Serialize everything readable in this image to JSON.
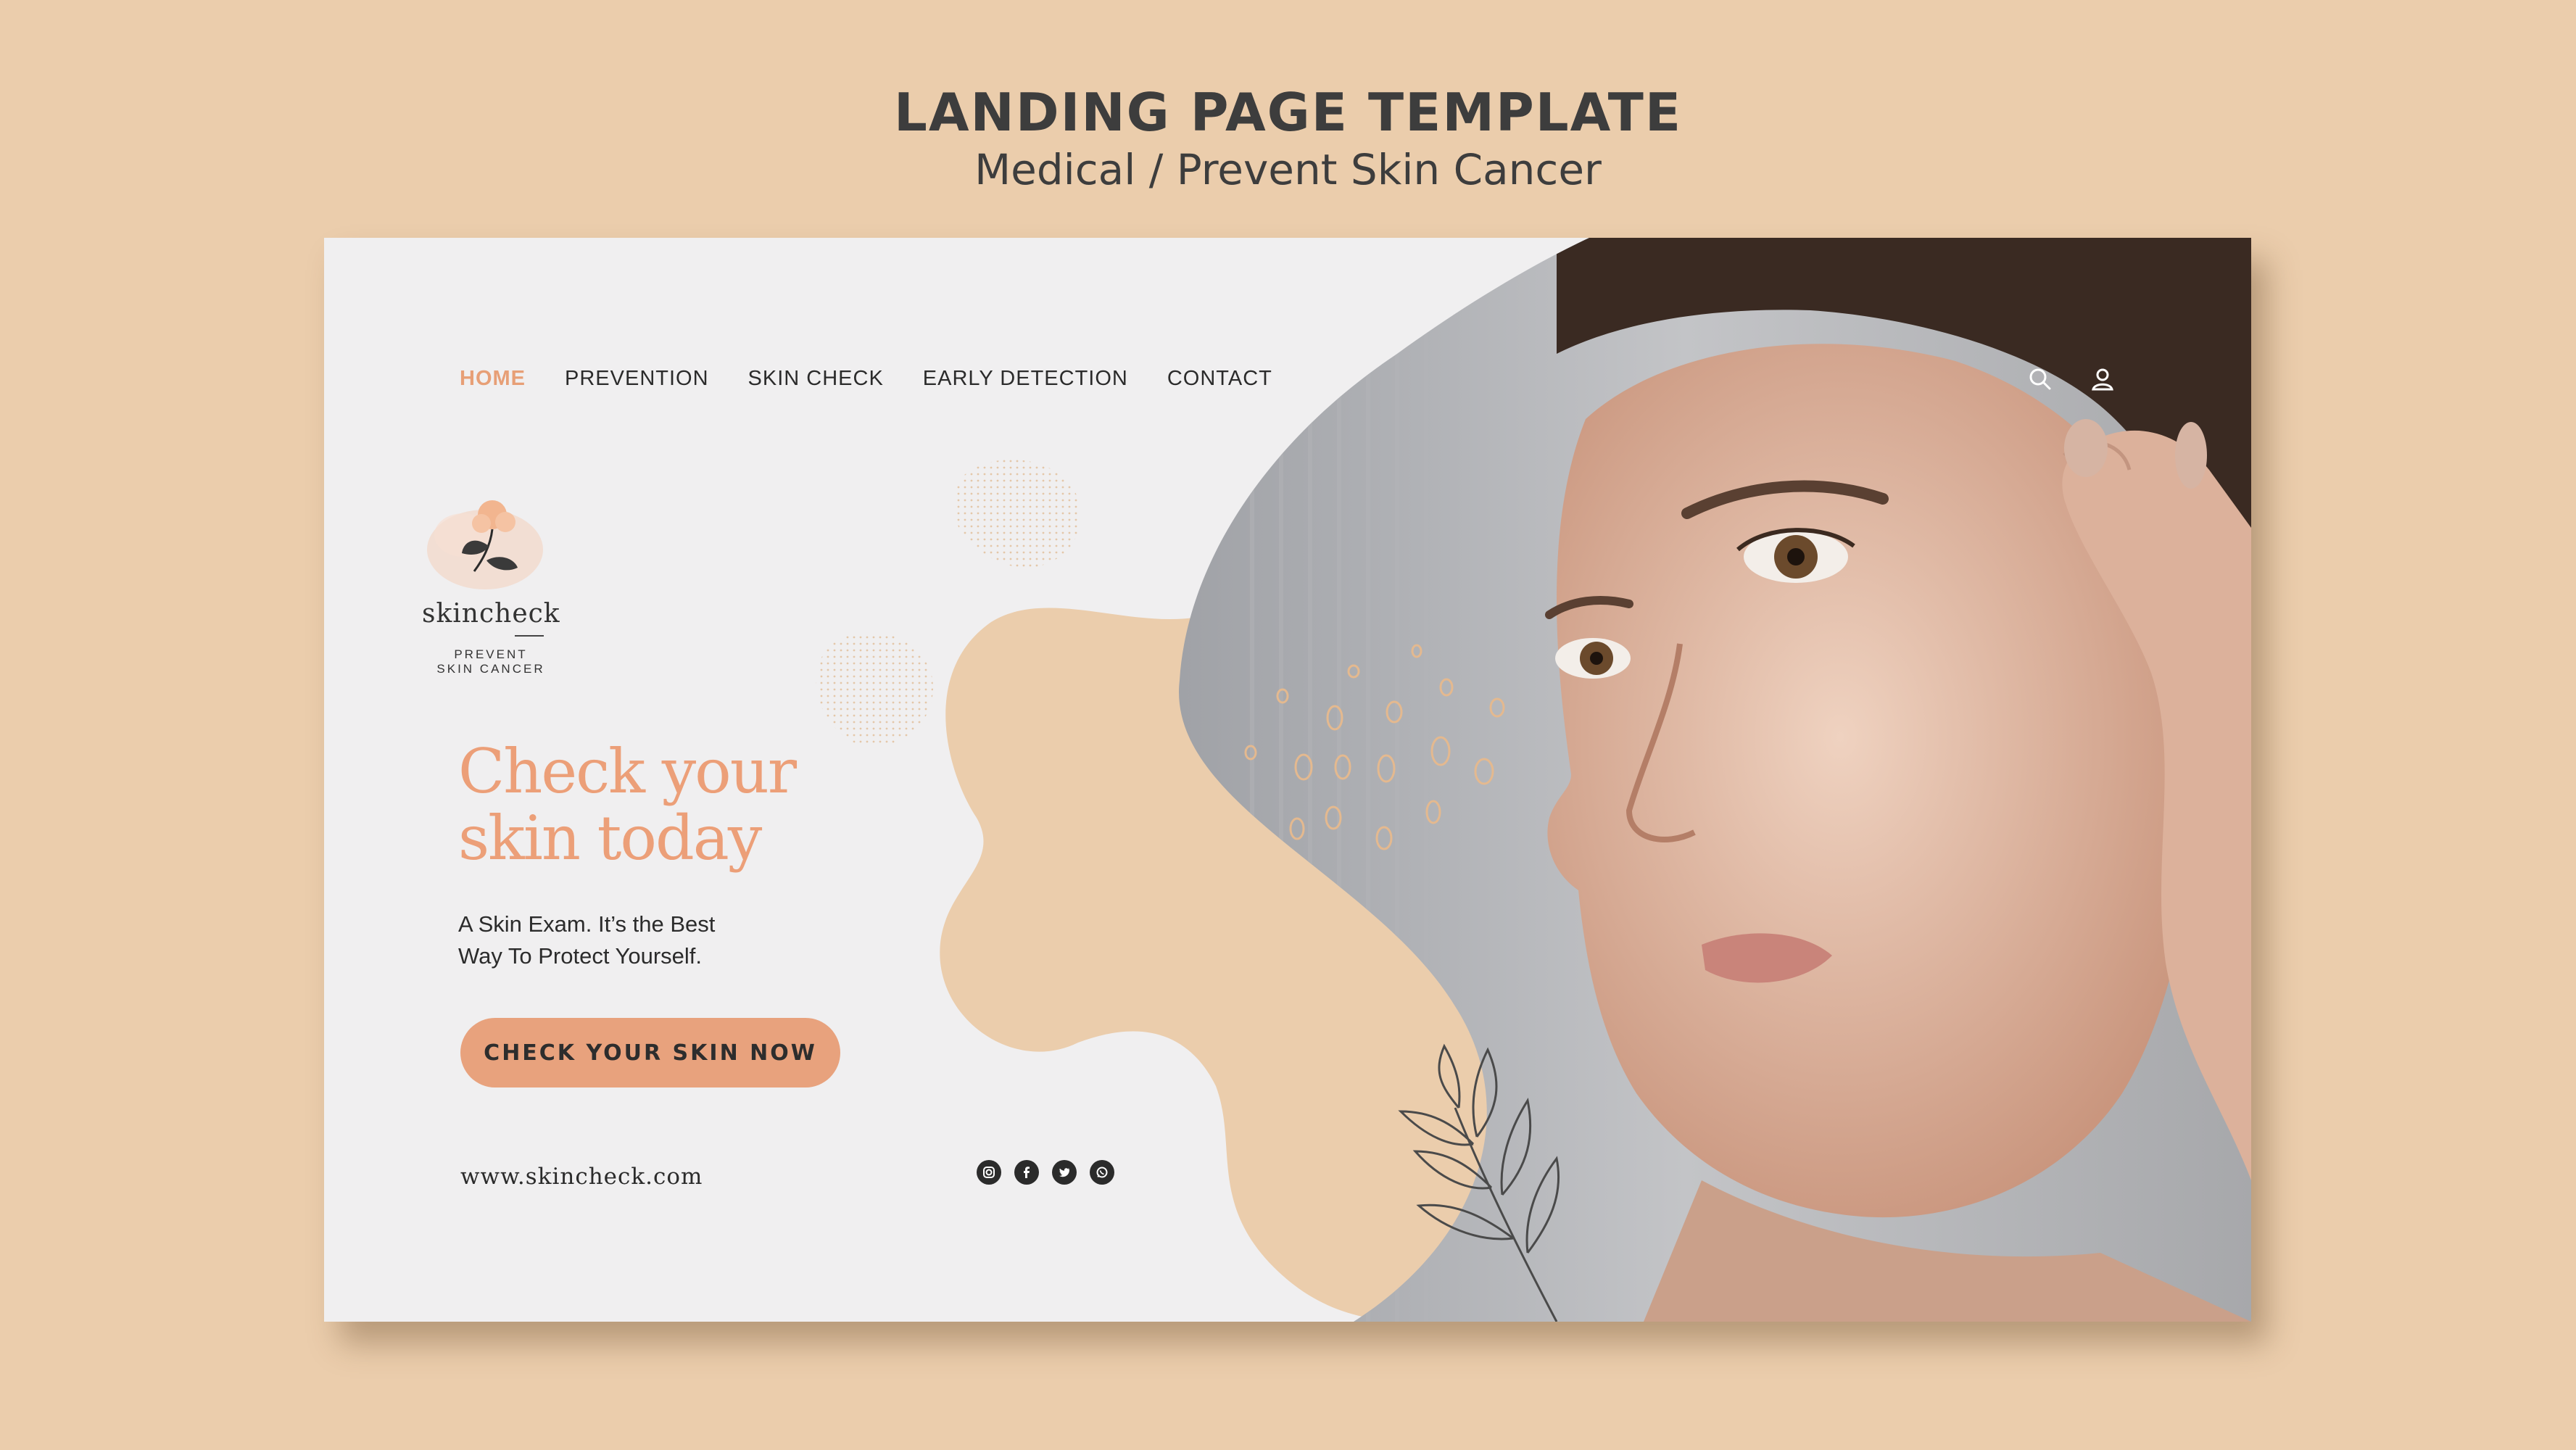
{
  "header": {
    "title": "LANDING PAGE TEMPLATE",
    "subtitle": "Medical / Prevent Skin Cancer"
  },
  "nav": {
    "items": [
      {
        "label": "HOME",
        "active": true
      },
      {
        "label": "PREVENTION"
      },
      {
        "label": "SKIN CHECK"
      },
      {
        "label": "EARLY DETECTION"
      },
      {
        "label": "CONTACT"
      }
    ]
  },
  "icons": [
    "search-icon",
    "user-icon"
  ],
  "logo": {
    "name": "skincheck",
    "tagline_line1": "PREVENT",
    "tagline_line2": "SKIN CANCER"
  },
  "hero": {
    "headline_line1": "Check your",
    "headline_line2": "skin today",
    "subtext_line1": "A Skin Exam. It’s the Best",
    "subtext_line2": "Way To Protect Yourself.",
    "cta_label": "CHECK YOUR SKIN NOW"
  },
  "footer": {
    "website": "www.skincheck.com",
    "social": [
      "instagram-icon",
      "facebook-icon",
      "twitter-icon",
      "whatsapp-icon"
    ]
  },
  "colors": {
    "page_bg": "#ebcdac",
    "card_bg": "#f0eff0",
    "accent": "#e8a27d",
    "blob": "#ebcdac",
    "text": "#2b2b2b"
  }
}
